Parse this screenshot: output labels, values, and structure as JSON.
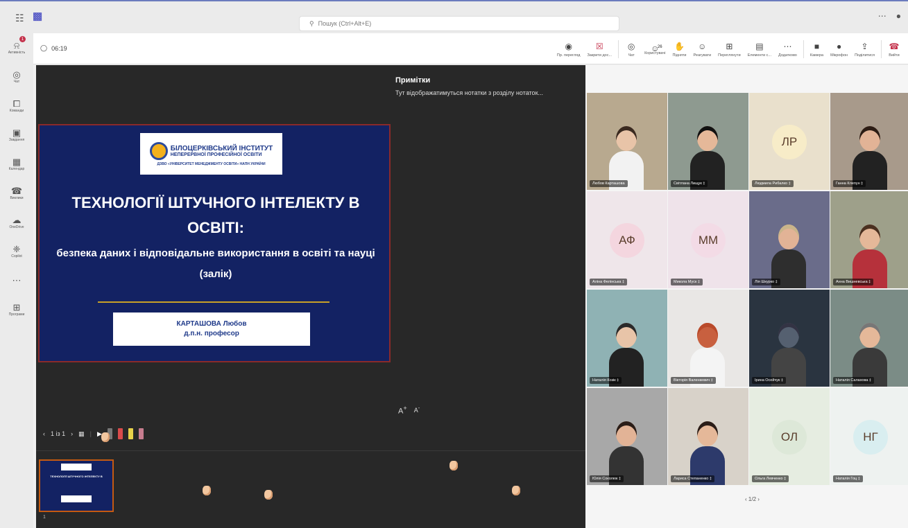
{
  "topbar": {
    "search_placeholder": "Пошук (Ctrl+Alt+E)"
  },
  "rail": [
    {
      "label": "Активність",
      "icon": "bell-icon",
      "badge": "1"
    },
    {
      "label": "Чат",
      "icon": "chat-icon"
    },
    {
      "label": "Команди",
      "icon": "teams-icon"
    },
    {
      "label": "Завдання",
      "icon": "tasks-icon"
    },
    {
      "label": "Календар",
      "icon": "calendar-icon"
    },
    {
      "label": "Виклики",
      "icon": "phone-icon"
    },
    {
      "label": "OneDrive",
      "icon": "cloud-icon"
    },
    {
      "label": "Copilot",
      "icon": "copilot-icon"
    },
    {
      "label": "...",
      "icon": "more-icon"
    },
    {
      "label": "Програми",
      "icon": "apps-icon"
    }
  ],
  "meeting": {
    "timer": "06:19",
    "controls": [
      {
        "label": "Пр. перегляд",
        "icon": "eye-icon"
      },
      {
        "label": "Закрити дос...",
        "icon": "close-share-icon",
        "color": "#c4314b"
      },
      {
        "label": "Чат",
        "icon": "chat-icon"
      },
      {
        "label": "Користувачі",
        "icon": "people-icon",
        "count": "26"
      },
      {
        "label": "Підняти",
        "icon": "hand-icon"
      },
      {
        "label": "Реагувати",
        "icon": "smile-icon"
      },
      {
        "label": "Переглянути",
        "icon": "view-icon"
      },
      {
        "label": "Елементи с...",
        "icon": "notes-icon"
      },
      {
        "label": "Додатково",
        "icon": "more-icon"
      },
      {
        "label": "Камера",
        "icon": "camera-icon"
      },
      {
        "label": "Мікрофон",
        "icon": "mic-icon"
      },
      {
        "label": "Поділитися",
        "icon": "share-icon"
      },
      {
        "label": "Вийти",
        "icon": "leave-icon",
        "color": "#c4314b"
      }
    ]
  },
  "slide": {
    "institute_line1": "БІЛОЦЕРКІВСЬКИЙ ІНСТИТУТ",
    "institute_line2": "НЕПЕРЕРВНОЇ ПРОФЕСІЙНОЇ ОСВІТИ",
    "institute_sub": "ДЗВО «УНІВЕРСИТЕТ МЕНЕДЖМЕНТУ ОСВІТИ» НАПН УКРАЇНИ",
    "title_line1": "ТЕХНОЛОГІЇ ШТУЧНОГО ІНТЕЛЕКТУ В",
    "title_line2": "ОСВІТІ:",
    "subtitle_line1": "безпека даних і відповідальне використання в освіті та науці",
    "subtitle_line2": "(залік)",
    "author_name": "КАРТАШОВА Любов",
    "author_title": "д.п.н. професор",
    "colors": {
      "background": "#132263",
      "border": "#8a2a2a",
      "accent_line": "#c9a227"
    }
  },
  "notes": {
    "title": "Примітки",
    "text": "Тут відображатимуться нотатки з розділу нотаток..."
  },
  "presenter_toolbar": {
    "page": "1 із 1",
    "font_up": "A",
    "font_down": "A"
  },
  "thumbnail": {
    "number": "1"
  },
  "gallery": {
    "pager": "1/2",
    "tiles": [
      {
        "name": "Любов Карташова",
        "type": "photo"
      },
      {
        "name": "Світлана Лищук",
        "type": "photo",
        "muted": true
      },
      {
        "name": "Людмила Рибалко",
        "type": "initials",
        "initials": "ЛР",
        "color": "#f7ecc8",
        "muted": true
      },
      {
        "name": "Ганна Клепун",
        "type": "photo",
        "muted": true
      },
      {
        "name": "Аліна Фелінська",
        "type": "initials",
        "initials": "АФ",
        "color": "#f4d6df",
        "muted": true
      },
      {
        "name": "Микола Муск",
        "type": "initials",
        "initials": "ММ",
        "color": "#f3dbe6",
        "muted": true
      },
      {
        "name": "Лія Шкурко",
        "type": "photo",
        "muted": true
      },
      {
        "name": "Анна Вишневська",
        "type": "photo",
        "muted": true
      },
      {
        "name": "Наталія Козік",
        "type": "photo",
        "muted": true
      },
      {
        "name": "Вікторія Валенкевич",
        "type": "photo",
        "muted": true
      },
      {
        "name": "Ірина Осейчук",
        "type": "photo",
        "muted": true
      },
      {
        "name": "Наталія Салахова",
        "type": "photo",
        "muted": true
      },
      {
        "name": "Юлія Соколюк",
        "type": "photo",
        "muted": true
      },
      {
        "name": "Лариса Степаненко",
        "type": "photo",
        "muted": true
      },
      {
        "name": "Ольга Левченко",
        "type": "initials",
        "initials": "ОЛ",
        "color": "#dde8d8",
        "muted": true
      },
      {
        "name": "Наталія Гоц",
        "type": "initials",
        "initials": "НГ",
        "color": "#d9eef0",
        "muted": true
      }
    ]
  }
}
